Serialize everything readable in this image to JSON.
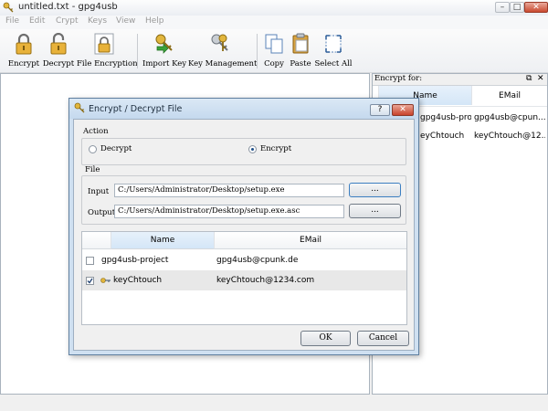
{
  "window": {
    "title": "untitled.txt - gpg4usb",
    "controls": [
      "–",
      "□",
      "✕"
    ]
  },
  "menu": [
    "File",
    "Edit",
    "Crypt",
    "Keys",
    "View",
    "Help"
  ],
  "toolbar": {
    "encrypt": "Encrypt",
    "decrypt": "Decrypt",
    "file_encryption": "File Encryption",
    "import_key": "Import Key",
    "key_management": "Key Management",
    "copy": "Copy",
    "paste": "Paste",
    "select_all": "Select All"
  },
  "encrypt_panel": {
    "title": "Encrypt for:",
    "columns": {
      "name": "Name",
      "email": "EMail"
    },
    "rows": [
      {
        "name": "gpg4usb-proj...",
        "email": "gpg4usb@cpun..."
      },
      {
        "name": "eyChtouch",
        "email": "keyChtouch@12..."
      }
    ]
  },
  "dialog": {
    "title": "Encrypt / Decrypt File",
    "action": {
      "label": "Action",
      "decrypt": "Decrypt",
      "encrypt": "Encrypt",
      "selected": "encrypt"
    },
    "file": {
      "label": "File",
      "input_label": "Input",
      "input_value": "C:/Users/Administrator/Desktop/setup.exe",
      "output_label": "Output",
      "output_value": "C:/Users/Administrator/Desktop/setup.exe.asc",
      "browse_label": "..."
    },
    "table": {
      "columns": {
        "name": "Name",
        "email": "EMail"
      },
      "rows": [
        {
          "name": "gpg4usb-project",
          "email": "gpg4usb@cpunk.de",
          "checked": false
        },
        {
          "name": "keyChtouch",
          "email": "keyChtouch@1234.com",
          "checked": true
        }
      ]
    },
    "ok": "OK",
    "cancel": "Cancel",
    "help": "?",
    "close": "✕"
  },
  "colors": {
    "dialog_frame": "#cfe0f1",
    "close_red": "#c8432b",
    "lock_gold": "#e8b23a"
  },
  "icons": [
    "app-key-icon",
    "lock-icon",
    "unlock-icon",
    "file-lock-icon",
    "key-import-icon",
    "key-management-icon",
    "copy-icon",
    "paste-icon",
    "select-all-icon"
  ]
}
